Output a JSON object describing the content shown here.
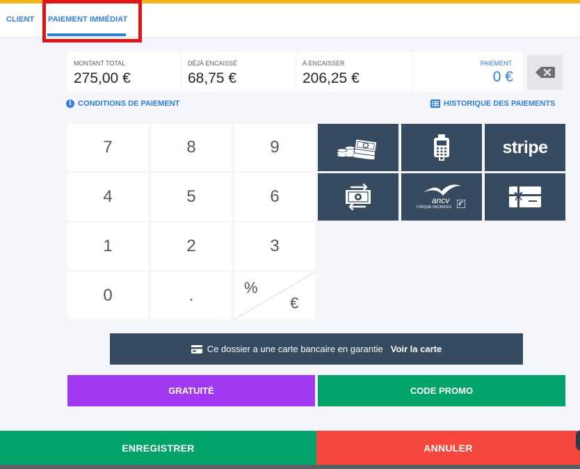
{
  "tabs": {
    "client": "CLIENT",
    "payment": "PAIEMENT IMMÉDIAT"
  },
  "summary": {
    "total_label": "MONTANT TOTAL",
    "total_value": "275,00 €",
    "collected_label": "DÉJÀ ENCAISSÉ",
    "collected_value": "68,75 €",
    "due_label": "À ENCAISSER",
    "due_value": "206,25 €",
    "payment_label": "PAIEMENT",
    "payment_value": "0 €"
  },
  "links": {
    "conditions": "CONDITIONS DE PAIEMENT",
    "history": "HISTORIQUE DES PAIEMENTS"
  },
  "keypad": {
    "keys": [
      "7",
      "8",
      "9",
      "4",
      "5",
      "6",
      "1",
      "2",
      "3",
      "0",
      "."
    ],
    "percent": "%",
    "euro": "€"
  },
  "payment_methods": {
    "stripe": "stripe",
    "ancv": "ancv",
    "ancv_sub": "CHÈQUE-VACANCES",
    "icons": [
      "cash-icon",
      "card-terminal-icon",
      "stripe-logo",
      "transfer-icon",
      "ancv-logo",
      "gift-card-icon"
    ]
  },
  "banner": {
    "text": "Ce dossier a une carte bancaire en garantie",
    "link": "Voir la carte"
  },
  "actions": {
    "gratuity": "GRATUITÉ",
    "promo": "CODE PROMO",
    "save": "ENREGISTRER",
    "cancel": "ANNULER"
  },
  "colors": {
    "accent": "#2f7ed8",
    "top_bar": "#f2b51f",
    "payment_tile": "#364a60",
    "gratuity": "#a238f2",
    "green": "#00a46b",
    "cancel": "#f5473d",
    "highlight": "#e0151a"
  }
}
